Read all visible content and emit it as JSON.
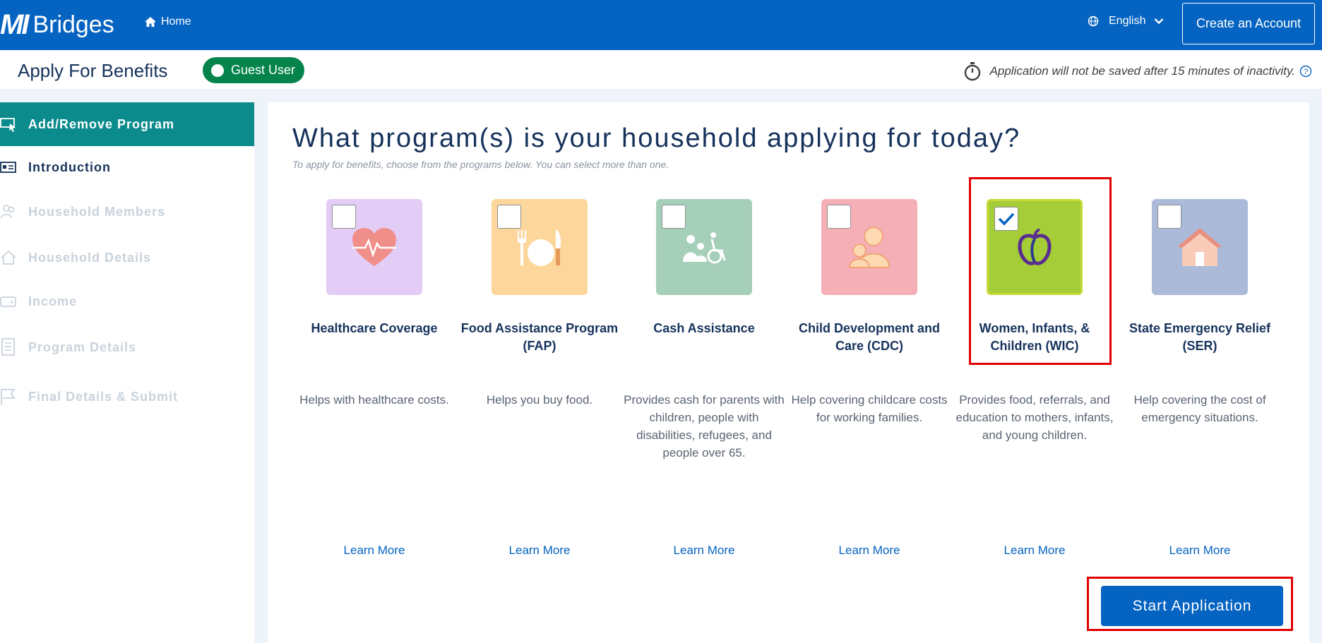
{
  "header": {
    "logo_mi": "MI",
    "logo_bridges": "Bridges",
    "home_label": "Home",
    "language_label": "English",
    "create_account_label": "Create an Account"
  },
  "subheader": {
    "title": "Apply For Benefits",
    "guest_label": "Guest User",
    "timeout_text": "Application will not be saved after 15 minutes of inactivity."
  },
  "sidebar": {
    "items": [
      {
        "label": "Add/Remove Program",
        "icon": "cursor-screen-icon"
      },
      {
        "label": "Introduction",
        "icon": "id-card-icon"
      },
      {
        "label": "Household Members",
        "icon": "people-icon"
      },
      {
        "label": "Household Details",
        "icon": "house-icon"
      },
      {
        "label": "Income",
        "icon": "wallet-icon"
      },
      {
        "label": "Program Details",
        "icon": "document-icon"
      },
      {
        "label": "Final Details & Submit",
        "icon": "flag-icon"
      }
    ]
  },
  "main": {
    "heading": "What program(s) is your household applying for today?",
    "subheading": "To apply for benefits, choose from the programs below. You can select more than one.",
    "learn_more": "Learn More",
    "start_label": "Start Application",
    "programs": [
      {
        "name": "Healthcare Coverage",
        "desc": "Helps with healthcare costs.",
        "color": "#e3ccf6",
        "icon": "heart-pulse-icon",
        "checked": false
      },
      {
        "name": "Food Assistance Program (FAP)",
        "desc": "Helps you buy food.",
        "color": "#fcd69b",
        "icon": "plate-utensils-icon",
        "checked": false
      },
      {
        "name": "Cash Assistance",
        "desc": "Provides cash for parents with children, people with disabilities, refugees, and people over 65.",
        "color": "#a6cfb9",
        "icon": "family-wheelchair-icon",
        "checked": false
      },
      {
        "name": "Child Development and Care (CDC)",
        "desc": "Help covering childcare costs for working families.",
        "color": "#f5afb6",
        "icon": "parent-child-icon",
        "checked": false
      },
      {
        "name": "Women, Infants, & Children (WIC)",
        "desc": "Provides food, referrals, and education to mothers, infants, and young children.",
        "color": "#a4cd37",
        "icon": "apple-icon",
        "checked": true
      },
      {
        "name": "State Emergency Relief (SER)",
        "desc": "Help covering the cost of emergency situations.",
        "color": "#abbad8",
        "icon": "house-icon",
        "checked": false
      }
    ]
  }
}
